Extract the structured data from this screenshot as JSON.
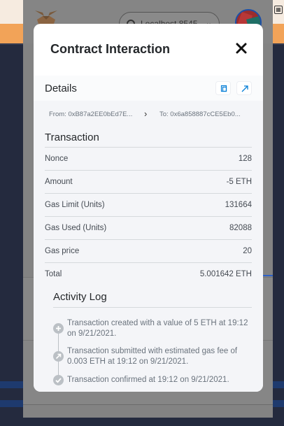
{
  "network": {
    "label": "Localhost 8545"
  },
  "modal": {
    "title": "Contract Interaction",
    "details_label": "Details",
    "from_label": "From: 0xB87a2EE0bEd7E...",
    "to_label": "To: 0x6a858887cCE5Eb0..."
  },
  "transaction": {
    "title": "Transaction",
    "rows": [
      {
        "key": "Nonce",
        "value": "128"
      },
      {
        "key": "Amount",
        "value": "-5 ETH"
      },
      {
        "key": "Gas Limit (Units)",
        "value": "131664"
      },
      {
        "key": "Gas Used (Units)",
        "value": "82088"
      },
      {
        "key": "Gas price",
        "value": "20"
      },
      {
        "key": "Total",
        "value": "5.001642 ETH"
      }
    ]
  },
  "activity": {
    "title": "Activity Log",
    "entries": [
      {
        "text": "Transaction created with a value of 5 ETH at 19:12 on 9/21/2021.",
        "icon": "plus-icon"
      },
      {
        "text": "Transaction submitted with estimated gas fee of 0.003 ETH at 19:12 on 9/21/2021.",
        "icon": "send-icon"
      },
      {
        "text": "Transaction confirmed at 19:12 on 9/21/2021.",
        "icon": "check-icon"
      }
    ]
  },
  "colors": {
    "accent": "#037dd6",
    "orange_banner": "#f2a358",
    "background": "#242a3e"
  }
}
